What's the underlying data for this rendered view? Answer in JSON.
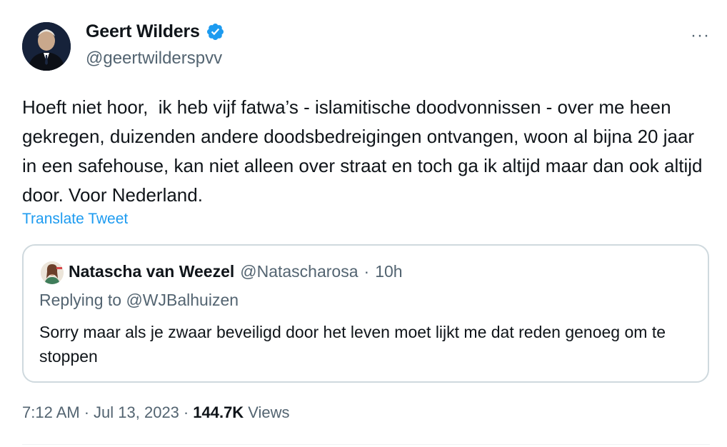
{
  "author": {
    "name": "Geert Wilders",
    "handle": "@geertwilderspvv",
    "verified": true,
    "verified_color": "#1d9bf0"
  },
  "more_label": "···",
  "tweet_text": "Hoeft niet hoor,  ik heb vijf fatwa’s - islamitische doodvonnissen - over me heen gekregen, duizenden andere doodsbedreigingen ontvangen, woon al bijna 20 jaar in een safehouse, kan niet alleen over straat en toch ga ik altijd maar dan ook altijd door. Voor Nederland.",
  "translate_label": "Translate Tweet",
  "quote": {
    "name": "Natascha van Weezel",
    "handle": "@Natascharosa",
    "separator": "·",
    "time": "10h",
    "replying_to": "Replying to @WJBalhuizen",
    "text": "Sorry maar als je zwaar beveiligd door het leven moet lijkt me dat reden genoeg om te stoppen"
  },
  "footer": {
    "time": "7:12 AM",
    "sep1": "·",
    "date": "Jul 13, 2023",
    "sep2": "·",
    "views_count": "144.7K",
    "views_label": "Views"
  },
  "colors": {
    "link": "#1d9bf0",
    "secondary_text": "#536471",
    "primary_text": "#0f1419",
    "border": "#cfd9de"
  }
}
